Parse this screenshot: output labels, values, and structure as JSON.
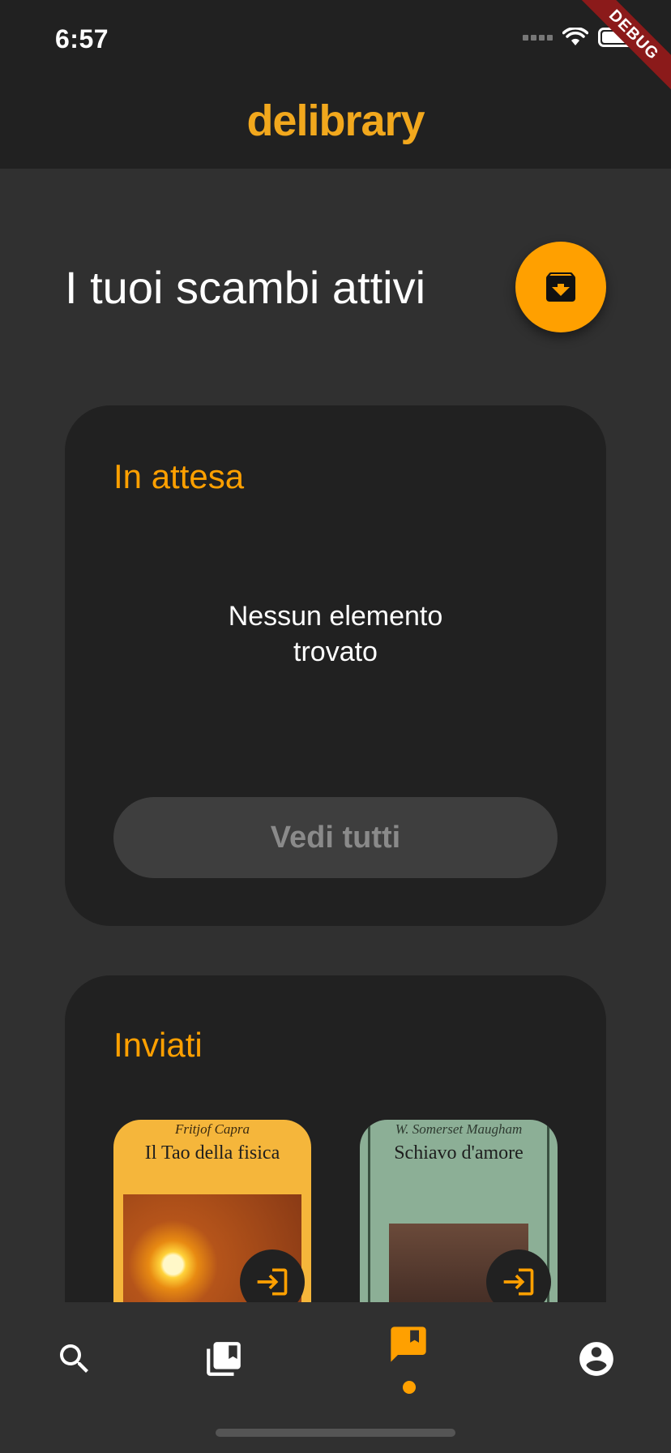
{
  "status_bar": {
    "time": "6:57",
    "debug_label": "DEBUG"
  },
  "app_bar": {
    "title": "delibrary"
  },
  "page": {
    "title": "I tuoi scambi attivi",
    "fab_icon": "archive-download-icon"
  },
  "pending": {
    "title": "In attesa",
    "empty_message": "Nessun elemento trovato",
    "see_all_label": "Vedi tutti"
  },
  "sent": {
    "title": "Inviati",
    "books": [
      {
        "author": "Fritjof Capra",
        "title": "Il Tao della fisica",
        "action_icon": "login-arrow-icon"
      },
      {
        "author": "W. Somerset Maugham",
        "title": "Schiavo d'amore",
        "action_icon": "login-arrow-icon"
      }
    ]
  },
  "bottom_nav": {
    "items": [
      {
        "icon": "search-icon",
        "active": false
      },
      {
        "icon": "library-books-icon",
        "active": false
      },
      {
        "icon": "exchange-bookmark-icon",
        "active": true
      },
      {
        "icon": "account-circle-icon",
        "active": false
      }
    ]
  },
  "colors": {
    "accent": "#ffa000",
    "brand": "#f2a81d",
    "card_bg": "#212121",
    "page_bg": "#303030"
  }
}
